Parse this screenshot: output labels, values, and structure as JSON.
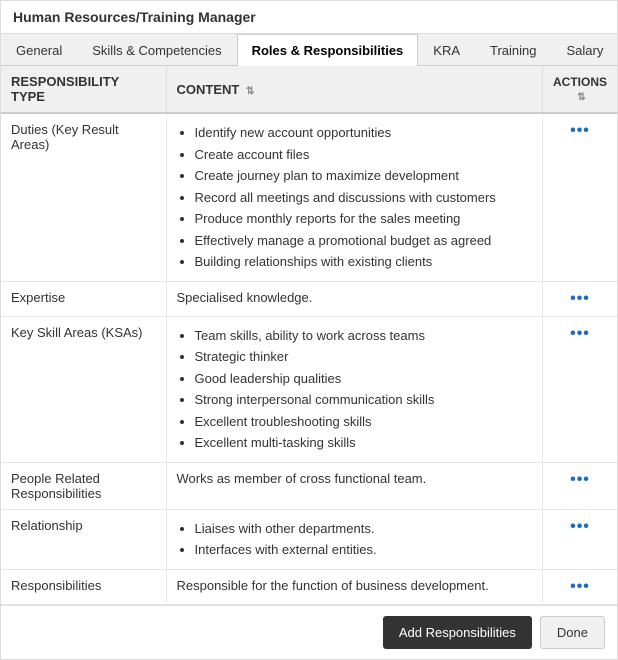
{
  "page": {
    "title": "Human Resources/Training Manager"
  },
  "tabs": [
    {
      "label": "General",
      "active": false
    },
    {
      "label": "Skills & Competencies",
      "active": false
    },
    {
      "label": "Roles & Responsibilities",
      "active": true
    },
    {
      "label": "KRA",
      "active": false
    },
    {
      "label": "Training",
      "active": false
    },
    {
      "label": "Salary",
      "active": false
    }
  ],
  "table": {
    "columns": [
      {
        "label": "RESPONSIBILITY TYPE",
        "sortable": false
      },
      {
        "label": "CONTENT",
        "sortable": true
      },
      {
        "label": "ACTIONS",
        "sortable": true
      }
    ],
    "rows": [
      {
        "type": "Duties (Key Result Areas)",
        "contentType": "bullets",
        "bullets": [
          "Identify new account opportunities",
          "Create account files",
          "Create journey plan to maximize development",
          "Record all meetings and discussions with customers",
          "Produce monthly reports for the sales meeting",
          "Effectively manage a promotional budget as agreed",
          "Building relationships with existing clients"
        ]
      },
      {
        "type": "Expertise",
        "contentType": "text",
        "text": "Specialised knowledge."
      },
      {
        "type": "Key Skill Areas (KSAs)",
        "contentType": "bullets",
        "bullets": [
          "Team skills, ability to work across teams",
          "Strategic thinker",
          "Good leadership qualities",
          "Strong interpersonal communication skills",
          "Excellent troubleshooting skills",
          "Excellent multi-tasking skills"
        ]
      },
      {
        "type": "People Related Responsibilities",
        "contentType": "text",
        "text": "Works as member of cross functional team."
      },
      {
        "type": "Relationship",
        "contentType": "bullets",
        "bullets": [
          "Liaises with other departments.",
          "Interfaces with external entities."
        ]
      },
      {
        "type": "Responsibilities",
        "contentType": "text",
        "text": "Responsible for the function of business development."
      }
    ]
  },
  "footer": {
    "add_label": "Add Responsibilities",
    "done_label": "Done"
  }
}
